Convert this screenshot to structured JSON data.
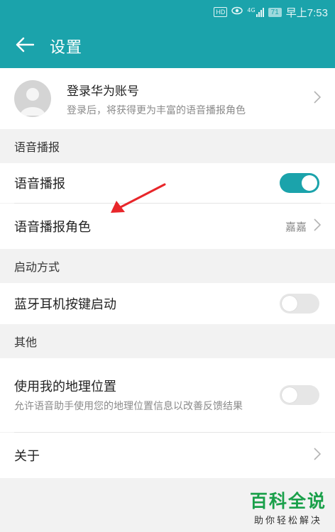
{
  "status_bar": {
    "hd_badge": "HD",
    "network": "4G",
    "battery": "71",
    "time": "早上7:53"
  },
  "toolbar": {
    "title": "设置",
    "back_icon": "arrow-left-icon"
  },
  "account": {
    "title": "登录华为账号",
    "subtitle": "登录后，将获得更为丰富的语音播报角色"
  },
  "sections": {
    "voice_header": "语音播报",
    "startup_header": "启动方式",
    "other_header": "其他"
  },
  "settings": {
    "voice_broadcast": {
      "label": "语音播报",
      "enabled": true
    },
    "voice_role": {
      "label": "语音播报角色",
      "value": "嘉嘉"
    },
    "bt_headset": {
      "label": "蓝牙耳机按键启动",
      "enabled": false
    },
    "location": {
      "label": "使用我的地理位置",
      "description": "允许语音助手使用您的地理位置信息以改善反馈结果",
      "enabled": false
    },
    "about": {
      "label": "关于"
    }
  },
  "watermark": {
    "title": "百科全说",
    "subtitle": "助你轻松解决"
  },
  "colors": {
    "accent": "#1ba3ab",
    "annotation_arrow": "#e8262a",
    "watermark_green": "#1aa04a"
  }
}
